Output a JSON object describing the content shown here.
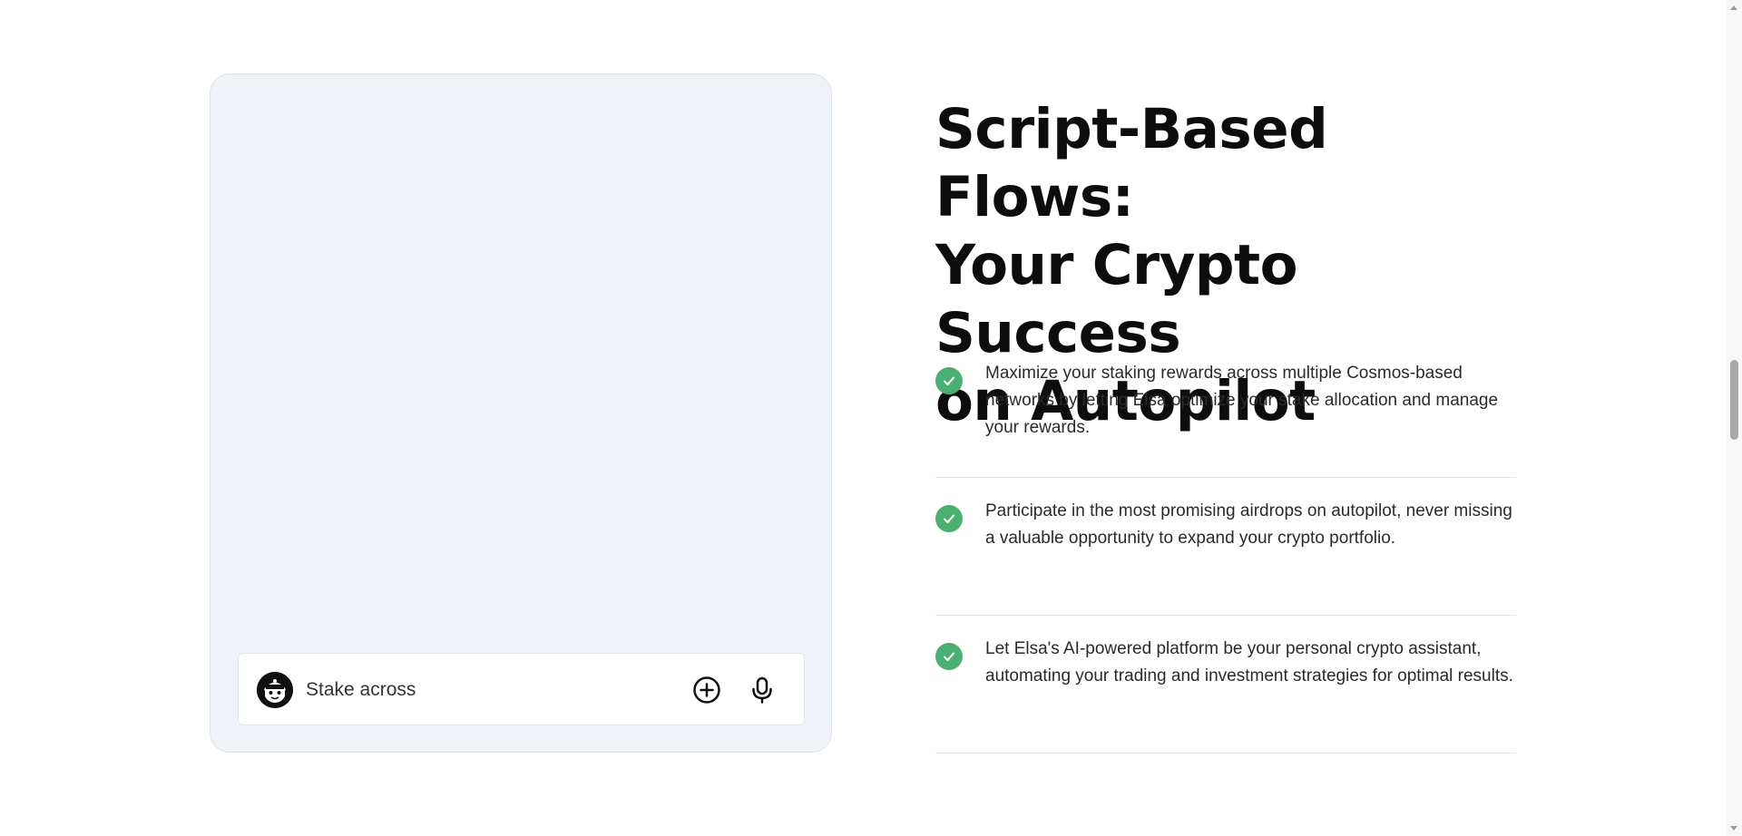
{
  "demo": {
    "input_value": "Stake across",
    "avatar_icon": "robot-avatar-icon",
    "add_icon": "plus-circle-icon",
    "mic_icon": "microphone-icon"
  },
  "section": {
    "headline_line1": "Script-Based Flows:",
    "headline_line2": "Your Crypto Success",
    "headline_line3": "on Autopilot",
    "features": [
      {
        "icon": "check-circle-icon",
        "text": "Maximize your staking rewards across multiple Cosmos-based networks by letting Elsa optimize your stake allocation and manage your rewards."
      },
      {
        "icon": "check-circle-icon",
        "text": "Participate in the most promising airdrops on autopilot, never missing a valuable opportunity to expand your crypto portfolio."
      },
      {
        "icon": "check-circle-icon",
        "text": "Let Elsa's AI-powered platform be your personal crypto assistant, automating your trading and investment strategies for optimal results."
      }
    ]
  },
  "colors": {
    "card_bg": "#eff3f7",
    "check_green": "#4caf72",
    "headline": "#0d0d0d"
  }
}
